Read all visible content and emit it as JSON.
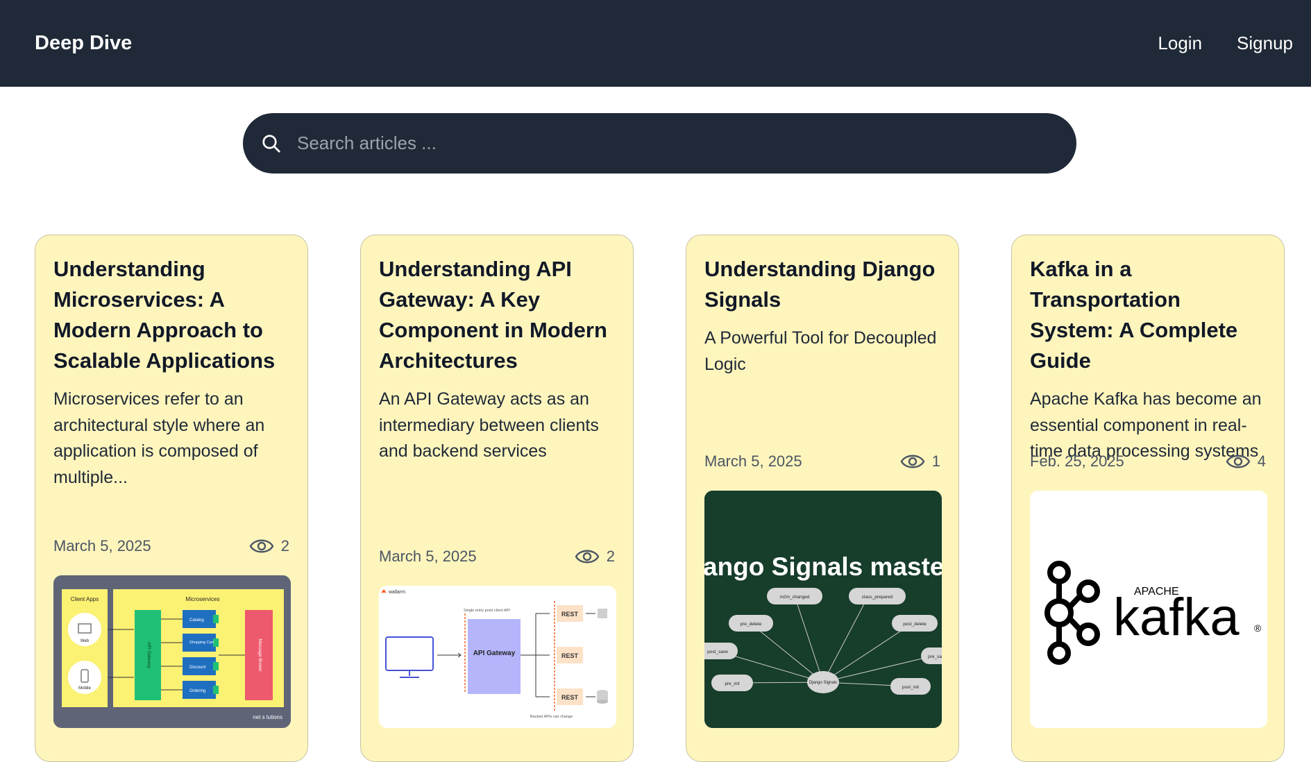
{
  "header": {
    "brand": "Deep Dive",
    "login": "Login",
    "signup": "Signup"
  },
  "search": {
    "placeholder": "Search articles ..."
  },
  "articles": [
    {
      "title": "Understanding Microservices: A Modern Approach to Scalable Applications",
      "description": "Microservices refer to an architectural style where an application is composed of multiple...",
      "date": "March 5, 2025",
      "views": "2",
      "image": {
        "left_heading": "Client Apps",
        "right_heading": "Microservices",
        "web": "Web",
        "mobile": "Mobile",
        "gateway": "API Gateway",
        "services": [
          "Catalog",
          "Shopping Cart",
          "Discount",
          "Ordering"
        ],
        "broker": "Message Broker",
        "watermark": "net s lutions"
      }
    },
    {
      "title": "Understanding API Gateway: A Key Component in Modern Architectures",
      "description": "An API Gateway acts as an intermediary between clients and backend services",
      "date": "March 5, 2025",
      "views": "2",
      "image": {
        "brand": "wallarm",
        "entry_note": "Single entry point client API",
        "gateway": "API Gateway",
        "rest": "REST",
        "backend_note": "Backed APIs can change"
      }
    },
    {
      "title": "Understanding Django Signals",
      "description": "A Powerful Tool for Decoupled Logic",
      "date": "March 5, 2025",
      "views": "1",
      "image": {
        "banner": "ango Signals maste",
        "center": "Django Signals",
        "nodes": [
          "m2m_changed",
          "class_prepared",
          "pre_delete",
          "post_delete",
          "post_save",
          "pre_sa",
          "pre_init",
          "post_init"
        ]
      }
    },
    {
      "title": "Kafka in a Transportation System: A Complete Guide",
      "description": "Apache Kafka has become an essential component in real-time data processing systems",
      "date": "Feb. 25, 2025",
      "views": "4",
      "image": {
        "apache": "APACHE",
        "name": "kafka",
        "registered": "®"
      }
    }
  ],
  "colors": {
    "navbar": "#1f2937",
    "card": "#fef5bd",
    "django_bg": "#173d2b"
  }
}
